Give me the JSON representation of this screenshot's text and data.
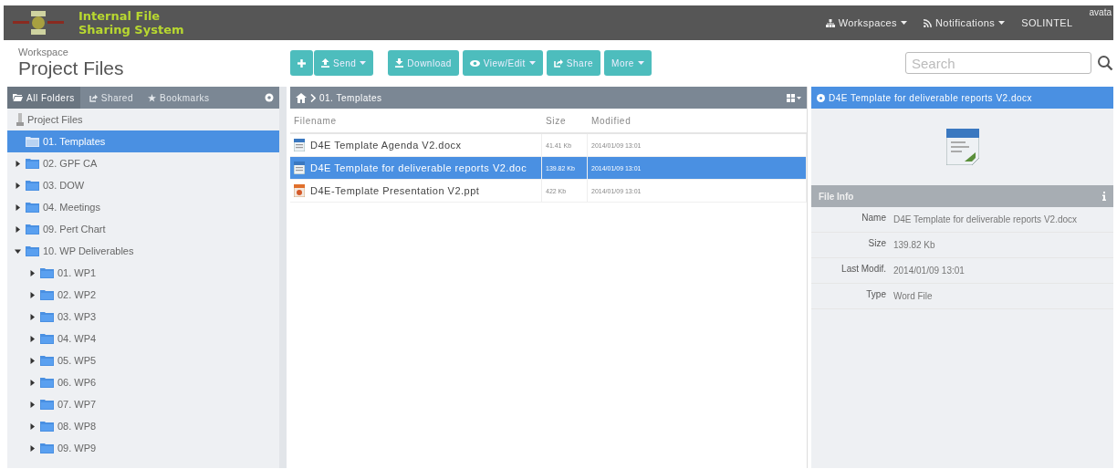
{
  "brand": {
    "title_line1": "Internal File",
    "title_line2": "Sharing System"
  },
  "navbar": {
    "items": [
      {
        "label": "Workspaces",
        "dropdown": true
      },
      {
        "label": "Notifications",
        "dropdown": true
      },
      {
        "label": "SOLINTEL",
        "dropdown": false
      }
    ],
    "avatar": "avata"
  },
  "header": {
    "subtitle": "Workspace",
    "title": "Project Files"
  },
  "toolbar": [
    {
      "dropdown": false
    },
    {
      "label": "Send",
      "dropdown": true
    },
    {
      "label": "Download",
      "dropdown": false
    },
    {
      "label": "View/Edit",
      "dropdown": true
    },
    {
      "label": "Share",
      "dropdown": false
    },
    {
      "label": "More",
      "dropdown": true
    }
  ],
  "search": {
    "placeholder": "Search"
  },
  "sidebar": {
    "tabs": [
      {
        "label": "All Folders",
        "selected": true
      },
      {
        "label": "Shared",
        "selected": false
      },
      {
        "label": "Bookmarks",
        "selected": false
      }
    ],
    "tree": {
      "label": "Project Files",
      "children": [
        {
          "label": "01. Templates",
          "selected": true
        },
        {
          "label": "02. GPF CA",
          "selected": false,
          "expanded": false
        },
        {
          "label": "03. DOW",
          "selected": false,
          "expanded": false
        },
        {
          "label": "04. Meetings",
          "selected": false,
          "expanded": false
        },
        {
          "label": "09. Pert Chart",
          "selected": false,
          "expanded": false
        },
        {
          "label": "10. WP Deliverables",
          "selected": false,
          "expanded": true,
          "children": [
            {
              "label": "01. WP1",
              "selected": false,
              "expanded": false
            },
            {
              "label": "02. WP2",
              "selected": false,
              "expanded": false
            },
            {
              "label": "03. WP3",
              "selected": false,
              "expanded": false
            },
            {
              "label": "04. WP4",
              "selected": false,
              "expanded": false
            },
            {
              "label": "05. WP5",
              "selected": false,
              "expanded": false
            },
            {
              "label": "06. WP6",
              "selected": false,
              "expanded": false
            },
            {
              "label": "07. WP7",
              "selected": false,
              "expanded": false
            },
            {
              "label": "08. WP8",
              "selected": false,
              "expanded": false
            },
            {
              "label": "09. WP9",
              "selected": false,
              "expanded": false
            }
          ]
        }
      ]
    }
  },
  "files": {
    "breadcrumb": "01. Templates",
    "columns": [
      "Filename",
      "Size",
      "Modified"
    ],
    "rows": [
      {
        "name": "D4E Template Agenda V2.docx",
        "size": "41.41 Kb",
        "modified": "2014/01/09 13:01",
        "kind": "word",
        "selected": false
      },
      {
        "name": "D4E Template for deliverable reports V2.doc",
        "size": "139.82 Kb",
        "modified": "2014/01/09 13:01",
        "kind": "word",
        "selected": true
      },
      {
        "name": "D4E-Template Presentation V2.ppt",
        "size": "422 Kb",
        "modified": "2014/01/09 13:01",
        "kind": "ppt",
        "selected": false
      }
    ]
  },
  "details": {
    "title": "D4E Template for deliverable reports V2.docx",
    "section": "File Info",
    "fields": [
      {
        "label": "Name",
        "value": "D4E Template for deliverable reports V2.docx"
      },
      {
        "label": "Size",
        "value": "139.82 Kb"
      },
      {
        "label": "Last Modif.",
        "value": "2014/01/09 13:01"
      },
      {
        "label": "Type",
        "value": "Word File"
      }
    ]
  }
}
